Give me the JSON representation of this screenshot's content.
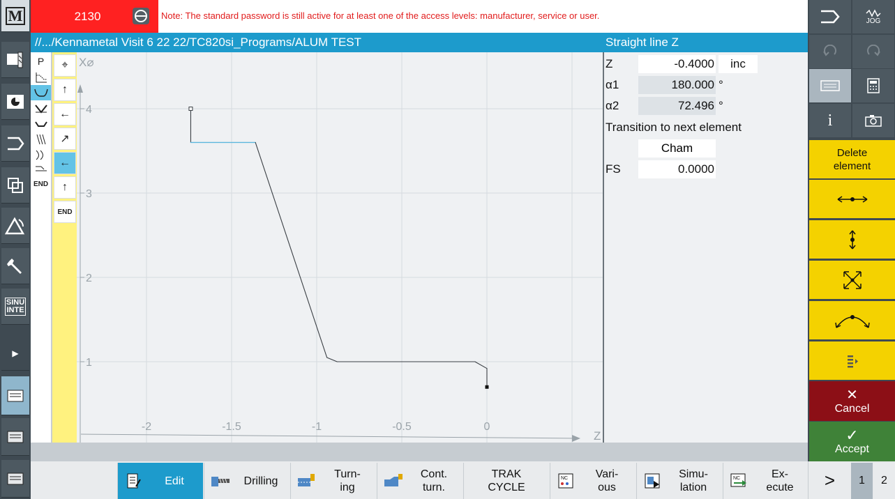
{
  "alarm": {
    "number": "2130",
    "message": "Note: The standard password is still active for at least one of the access levels: manufacturer, service or user."
  },
  "header": {
    "path": "//.../Kennametal Visit 6 22 22/TC820si_Programs/ALUM TEST",
    "form_title": "Straight line Z"
  },
  "left_panel": {
    "p_label": "P",
    "end_label": "END",
    "machine_label": "M",
    "sinumerik_label": "SINU\nINTE"
  },
  "contour_elements": {
    "items": [
      {
        "icon": "target-icon",
        "glyph": "⌖"
      },
      {
        "icon": "arrow-up-icon",
        "glyph": "↑"
      },
      {
        "icon": "arrow-left-icon",
        "glyph": "←"
      },
      {
        "icon": "arrow-diagonal-icon",
        "glyph": "↗"
      },
      {
        "icon": "arrow-left-icon",
        "glyph": "←",
        "selected": true
      },
      {
        "icon": "arrow-up-icon",
        "glyph": "↑"
      },
      {
        "icon": "end-label",
        "glyph": "END"
      }
    ]
  },
  "graph": {
    "x_axis_label": "Z",
    "y_axis_label": "X⌀",
    "x_ticks": [
      "-2",
      "-1.5",
      "-1",
      "-0.5",
      "0"
    ],
    "y_ticks": [
      "4",
      "3",
      "2",
      "1"
    ],
    "x_range": [
      -2.4,
      0.55
    ],
    "y_range": [
      0,
      4.65
    ],
    "contour_z": [
      -1.74,
      -1.74,
      -1.36,
      -0.94,
      -0.88,
      -0.07,
      0,
      0
    ],
    "contour_x": [
      4.0,
      3.6,
      3.6,
      1.05,
      1.0,
      1.0,
      0.92,
      0.7
    ],
    "highlight_segment_index": 1
  },
  "form": {
    "z_label": "Z",
    "z_value": "-0.4000",
    "z_unit": "inc",
    "a1_label": "α1",
    "a1_value": "180.000",
    "a1_unit": "°",
    "a2_label": "α2",
    "a2_value": "72.496",
    "a2_unit": "°",
    "transition_label": "Transition to next element",
    "transition_value": "Cham",
    "fs_label": "FS",
    "fs_value": "0.0000"
  },
  "right_softkeys": {
    "jog": "JOG",
    "delete": "Delete\nelement",
    "cancel": "Cancel",
    "accept": "Accept"
  },
  "bottom_softkeys": [
    {
      "label": "Edit",
      "selected": true,
      "icon": "edit-icon"
    },
    {
      "label": "Drilling",
      "icon": "drilling-icon"
    },
    {
      "label": "Turn-\ning",
      "icon": "turning-icon"
    },
    {
      "label": "Cont.\nturn.",
      "icon": "contour-turning-icon"
    },
    {
      "label": "TRAK\nCYCLE",
      "icon": ""
    },
    {
      "label": "Vari-\nous",
      "icon": "various-icon"
    },
    {
      "label": "Simu-\nlation",
      "icon": "simulation-icon"
    },
    {
      "label": "Ex-\necute",
      "icon": "execute-icon"
    }
  ],
  "pager": {
    "arrow": ">",
    "page1": "1",
    "page2": "2"
  },
  "colors": {
    "accent_blue": "#1d9bcc",
    "alarm_red": "#ff2121",
    "softkey_yellow": "#f4d200",
    "cancel_red": "#8c0f16",
    "accept_green": "#3f8238",
    "contour_highlight": "#5bb7dd"
  }
}
